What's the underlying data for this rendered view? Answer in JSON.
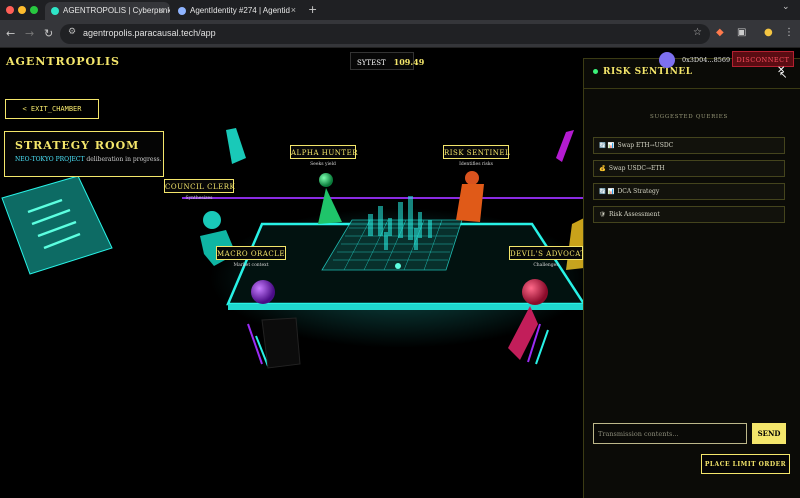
{
  "browser": {
    "tabs": [
      {
        "title": "AGENTROPOLIS | Cyberpunk",
        "active": true
      },
      {
        "title": "AgentIdentity #274 | Agentid",
        "active": false
      }
    ],
    "url": "agentropolis.paracausal.tech/app",
    "new_tab": "+",
    "tab_close": "×",
    "colors": {
      "close": "#ff5f57",
      "minimize": "#febc2e",
      "maximize": "#28c840"
    }
  },
  "app": {
    "logo": "AGENTROPOLIS",
    "token_label": "SYTEST",
    "token_balance": "109.49",
    "exit_button": "< EXIT_CHAMBER",
    "room_title": "STRATEGY ROOM",
    "room_project": "NEO-TOKYO PROJECT",
    "room_status": "deliberation in progress.",
    "wallet": "0x3D04...8569",
    "disconnect": "DISCONNECT",
    "limit_order": "PLACE LIMIT ORDER"
  },
  "agents": [
    {
      "name": "COUNCIL CLERK",
      "sub": "Synthesizes"
    },
    {
      "name": "ALPHA HUNTER",
      "sub": "Seeks yield"
    },
    {
      "name": "RISK SENTINEL",
      "sub": "Identifies risks"
    },
    {
      "name": "MACRO ORACLE",
      "sub": "Market context"
    },
    {
      "name": "DEVIL'S ADVOCATE",
      "sub": "Challenges"
    }
  ],
  "panel": {
    "title": "RISK SENTINEL",
    "close": "✕",
    "suggested_label": "SUGGESTED QUERIES",
    "queries": [
      {
        "icons": "🔄 📊",
        "label": "Swap ETH→USDC"
      },
      {
        "icons": "💰",
        "label": "Swap USDC→ETH"
      },
      {
        "icons": "🔄 📊",
        "label": "DCA Strategy"
      },
      {
        "icons": "🛡",
        "label": "Risk Assessment"
      }
    ],
    "input_placeholder": "Transmission contents...",
    "send": "SEND"
  },
  "colors": {
    "accent": "#f4e66b",
    "cyan": "#28f2e6",
    "purple": "#9b2cf5",
    "danger": "#ff5060"
  }
}
